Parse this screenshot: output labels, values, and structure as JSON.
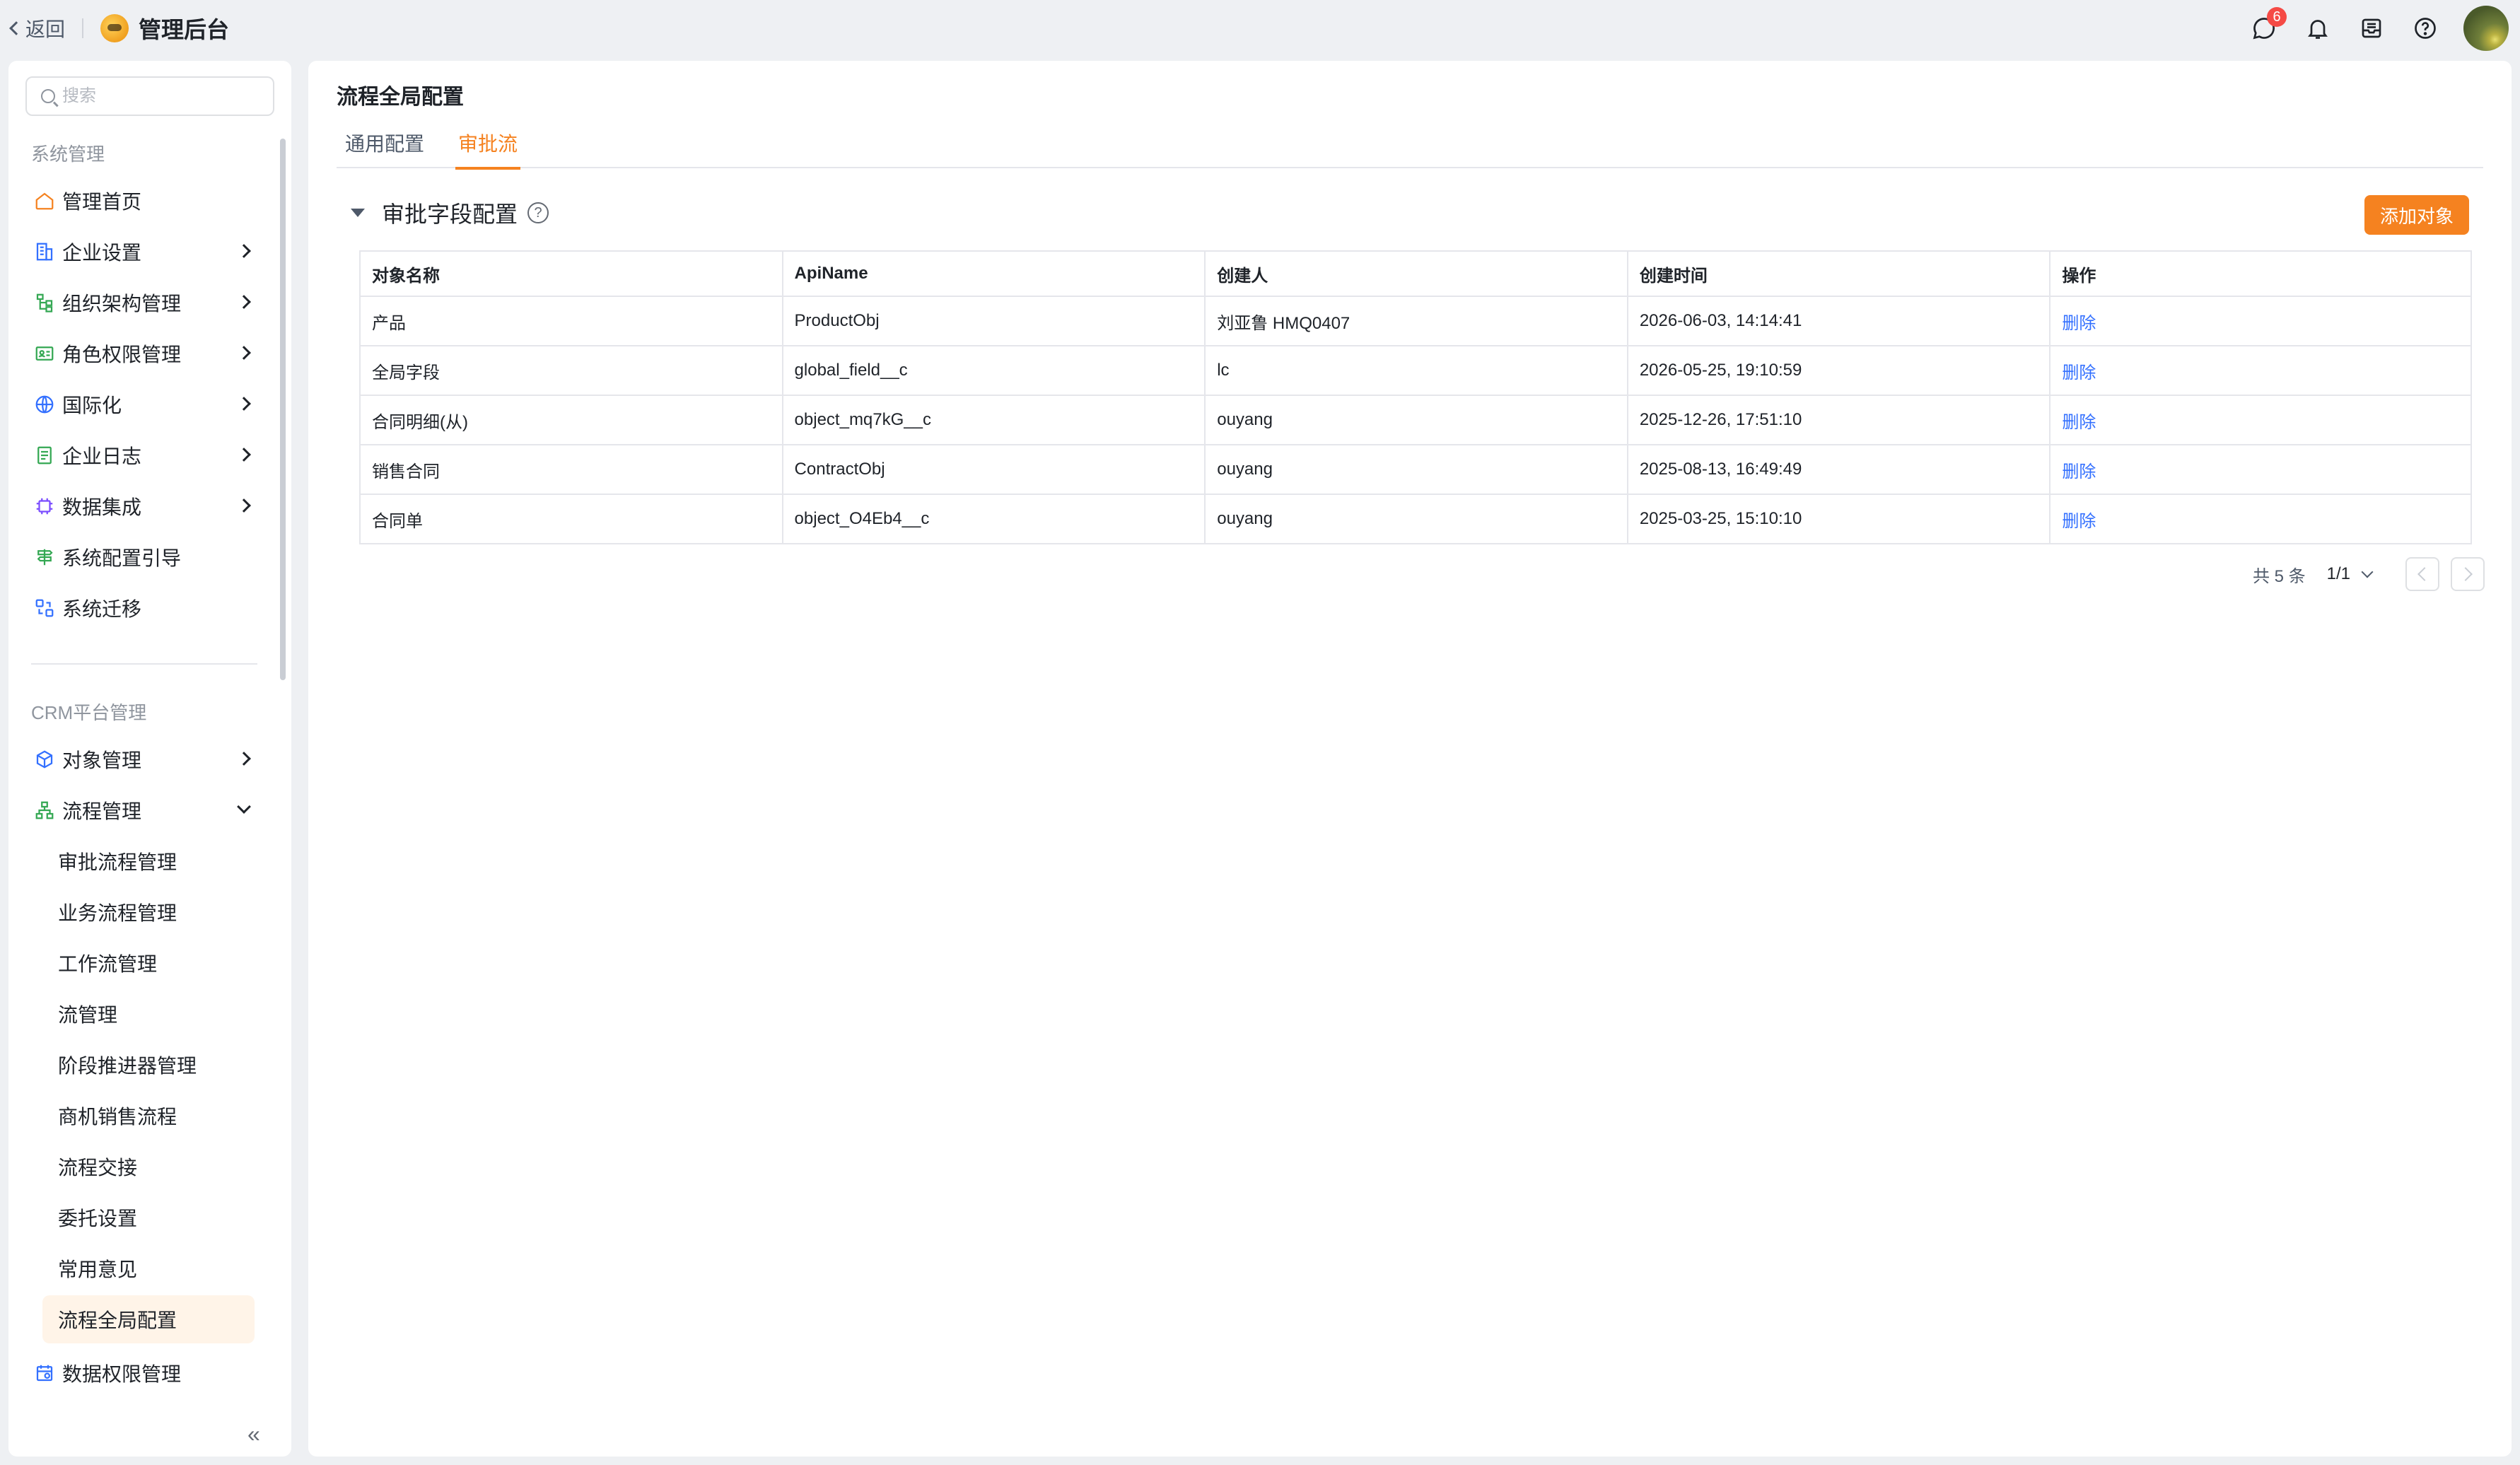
{
  "topbar": {
    "back_label": "返回",
    "app_title": "管理后台",
    "message_badge": "6"
  },
  "sidebar": {
    "search_placeholder": "搜索",
    "group1_title": "系统管理",
    "group1_items": [
      {
        "label": "管理首页",
        "icon": "home-icon"
      },
      {
        "label": "企业设置",
        "icon": "building-icon"
      },
      {
        "label": "组织架构管理",
        "icon": "org-icon"
      },
      {
        "label": "角色权限管理",
        "icon": "id-card-icon"
      },
      {
        "label": "国际化",
        "icon": "globe-icon"
      },
      {
        "label": "企业日志",
        "icon": "log-icon"
      },
      {
        "label": "数据集成",
        "icon": "chip-icon"
      },
      {
        "label": "系统配置引导",
        "icon": "signpost-icon"
      },
      {
        "label": "系统迁移",
        "icon": "migrate-icon"
      }
    ],
    "group2_title": "CRM平台管理",
    "group2_items": [
      {
        "label": "对象管理",
        "icon": "cube-icon"
      },
      {
        "label": "流程管理",
        "icon": "flow-icon"
      }
    ],
    "flow_sub_items": [
      "审批流程管理",
      "业务流程管理",
      "工作流管理",
      "流管理",
      "阶段推进器管理",
      "商机销售流程",
      "流程交接",
      "委托设置",
      "常用意见",
      "流程全局配置"
    ],
    "last_item": {
      "label": "数据权限管理",
      "icon": "data-permission-icon"
    },
    "collapse_glyph": "«"
  },
  "main": {
    "page_title": "流程全局配置",
    "tabs": [
      "通用配置",
      "审批流"
    ],
    "active_tab": "审批流",
    "section_title": "审批字段配置",
    "help_glyph": "?",
    "add_button": "添加对象",
    "table": {
      "headers": [
        "对象名称",
        "ApiName",
        "创建人",
        "创建时间",
        "操作"
      ],
      "rows": [
        [
          "产品",
          "ProductObj",
          "刘亚鲁 HMQ0407",
          "2026-06-03, 14:14:41",
          "删除"
        ],
        [
          "全局字段",
          "global_field__c",
          "lc",
          "2026-05-25, 19:10:59",
          "删除"
        ],
        [
          "合同明细(从)",
          "object_mq7kG__c",
          "ouyang",
          "2025-12-26, 17:51:10",
          "删除"
        ],
        [
          "销售合同",
          "ContractObj",
          "ouyang",
          "2025-08-13, 16:49:49",
          "删除"
        ],
        [
          "合同单",
          "object_O4Eb4__c",
          "ouyang",
          "2025-03-25, 15:10:10",
          "删除"
        ]
      ]
    },
    "pager": {
      "total": "共 5 条",
      "page": "1/1"
    }
  },
  "colors": {
    "accent": "#f58220",
    "link": "#3370ff",
    "active_bg": "#fff4e8"
  }
}
